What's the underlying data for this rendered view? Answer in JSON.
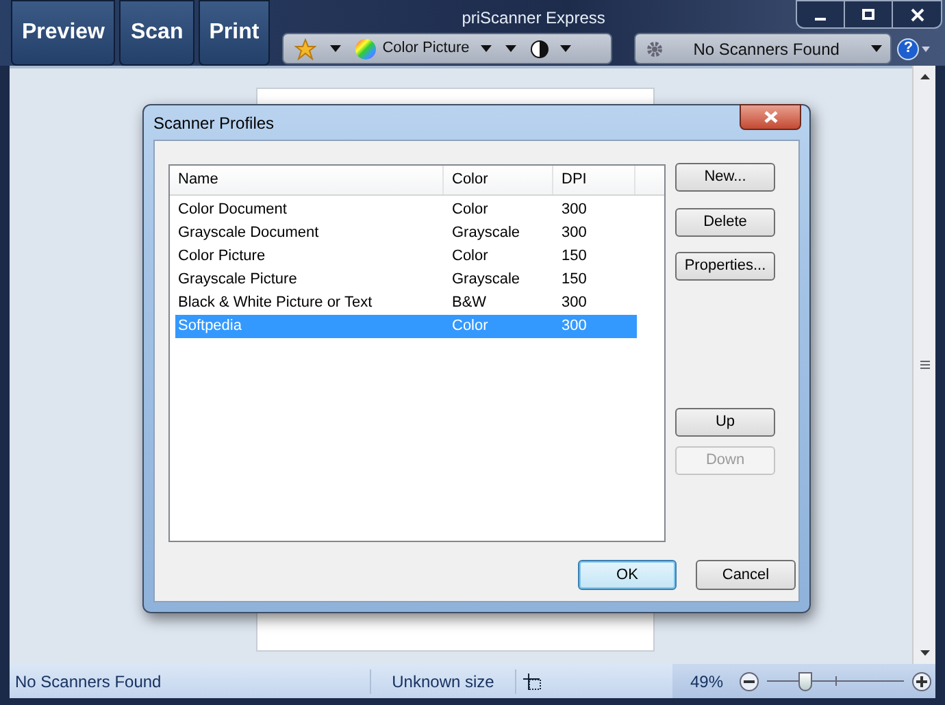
{
  "window": {
    "title": "priScanner Express"
  },
  "toolbar": {
    "buttons": [
      {
        "label": "Preview"
      },
      {
        "label": "Scan"
      },
      {
        "label": "Print"
      }
    ],
    "color_mode": "Color Picture",
    "scanner": "No Scanners Found",
    "help": "?"
  },
  "dialog": {
    "title": "Scanner Profiles",
    "columns": [
      "Name",
      "Color",
      "DPI"
    ],
    "rows": [
      {
        "cells": [
          "Color Document",
          "Color",
          "300"
        ],
        "selected": false
      },
      {
        "cells": [
          "Grayscale Document",
          "Grayscale",
          "300"
        ],
        "selected": false
      },
      {
        "cells": [
          "Color Picture",
          "Color",
          "150"
        ],
        "selected": false
      },
      {
        "cells": [
          "Grayscale Picture",
          "Grayscale",
          "150"
        ],
        "selected": false
      },
      {
        "cells": [
          "Black & White Picture or Text",
          "B&W",
          "300"
        ],
        "selected": false
      },
      {
        "cells": [
          "Softpedia",
          "Color",
          "300"
        ],
        "selected": true
      }
    ],
    "side_buttons": [
      {
        "label": "New...",
        "disabled": false
      },
      {
        "label": "Delete",
        "disabled": false
      },
      {
        "label": "Properties...",
        "disabled": false
      },
      {
        "label": "Up",
        "disabled": false
      },
      {
        "label": "Down",
        "disabled": true
      }
    ],
    "ok": "OK",
    "cancel": "Cancel"
  },
  "status_bar": {
    "scanner": "No Scanners Found",
    "size": "Unknown size",
    "zoom": "49%",
    "zoom_slider": {
      "level": 0.28
    }
  }
}
